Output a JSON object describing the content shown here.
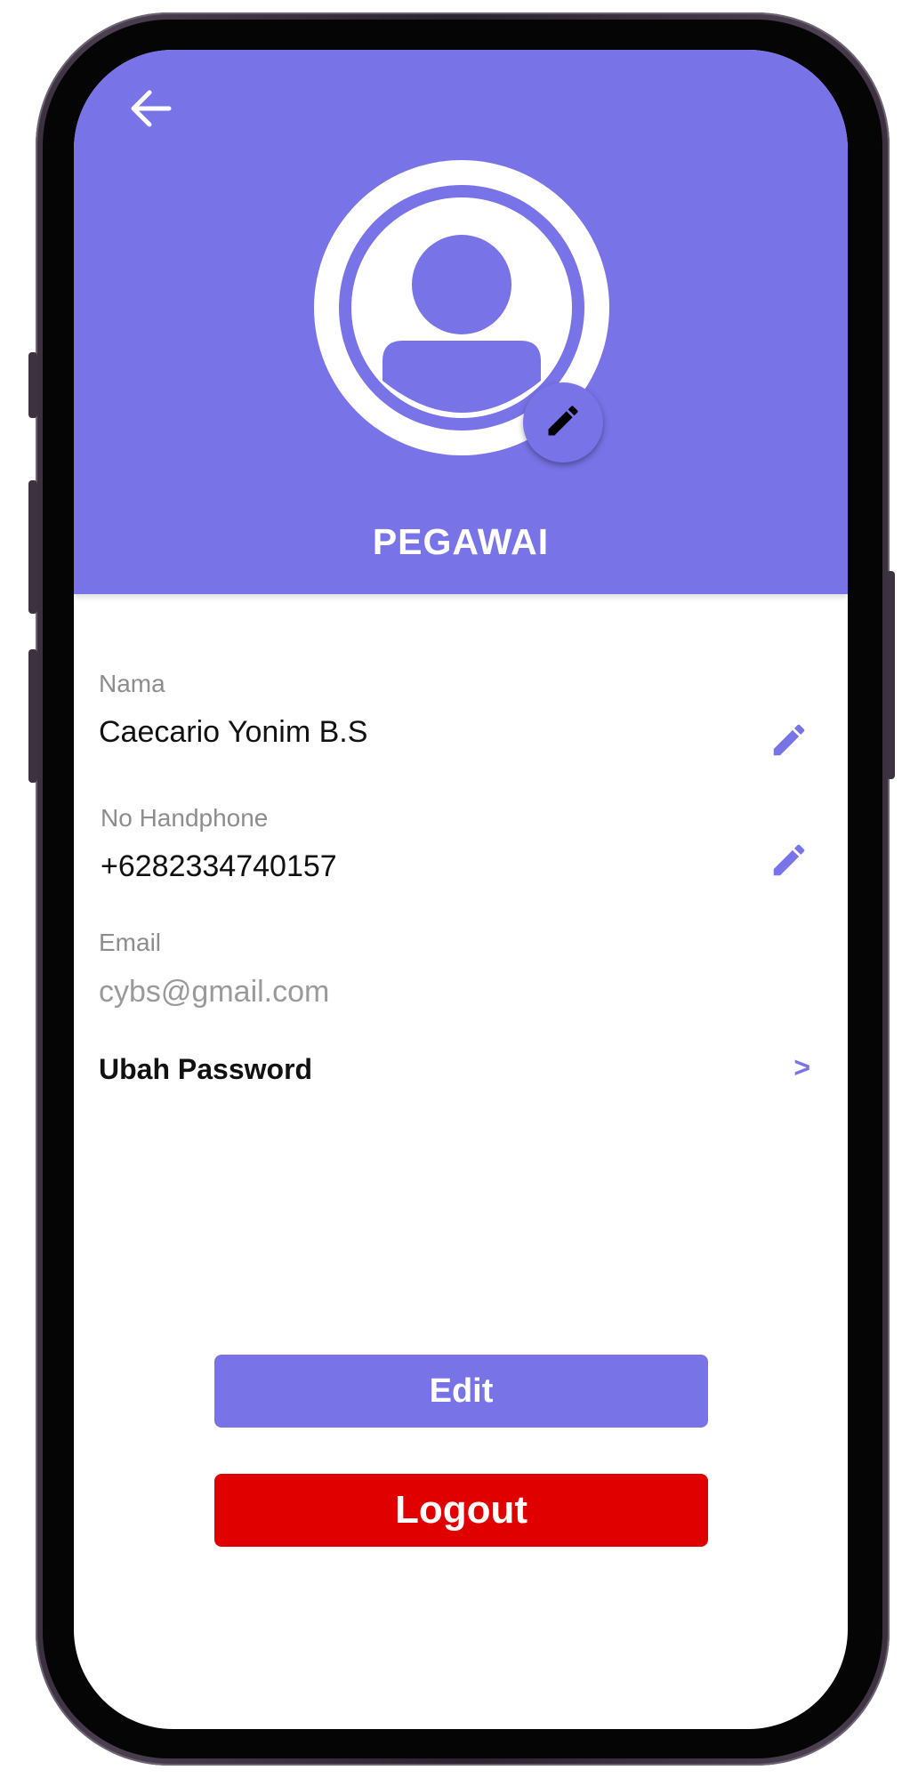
{
  "header": {
    "role_title": "PEGAWAI",
    "color": "#7873e6"
  },
  "icons": {
    "back": "arrow-left-icon",
    "avatar": "user-avatar-icon",
    "edit": "pencil-icon",
    "chevron": "chevron-right"
  },
  "fields": {
    "nama": {
      "label": "Nama",
      "value": "Caecario Yonim B.S"
    },
    "phone": {
      "label": "No Handphone",
      "value": "+6282334740157"
    },
    "email": {
      "label": "Email",
      "value": "cybs@gmail.com"
    }
  },
  "password": {
    "label": "Ubah Password",
    "arrow": ">"
  },
  "buttons": {
    "edit_label": "Edit",
    "logout_label": "Logout",
    "edit_color": "#7873e6",
    "logout_color": "#e00000"
  }
}
